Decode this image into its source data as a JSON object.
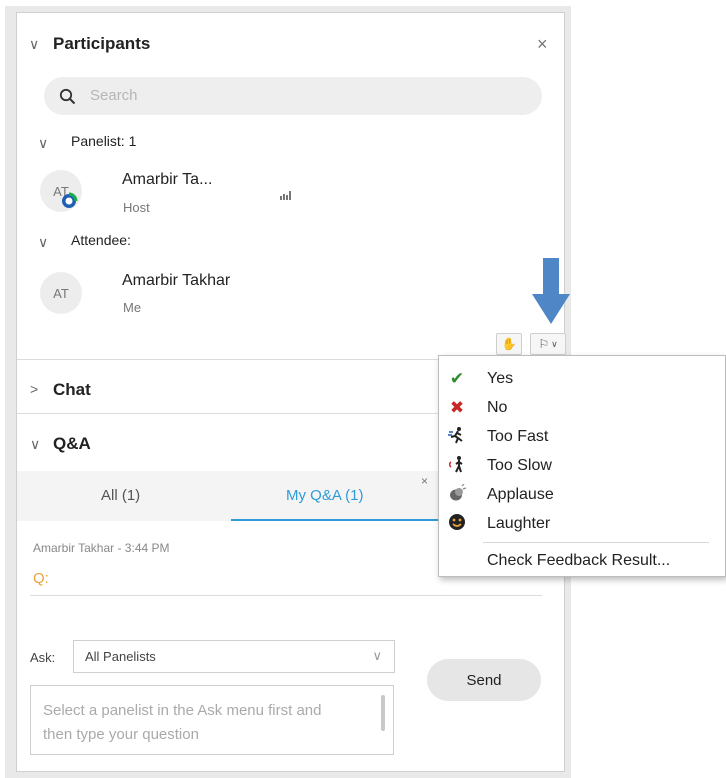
{
  "participants": {
    "title": "Participants",
    "search_placeholder": "Search",
    "panelist_group": "Panelist: 1",
    "attendee_group": "Attendee:",
    "panelist": {
      "initials": "AT",
      "name": "Amarbir Ta...",
      "role": "Host"
    },
    "attendee": {
      "initials": "AT",
      "name": "Amarbir Takhar",
      "role": "Me"
    }
  },
  "chat": {
    "title": "Chat"
  },
  "qa": {
    "title": "Q&A",
    "tabs": [
      "All (1)",
      "My Q&A (1)"
    ],
    "entry_meta": "Amarbir Takhar - 3:44 PM",
    "entry_q": "Q:",
    "ask_label": "Ask:",
    "ask_value": "All Panelists",
    "question_placeholder": "Select a panelist in the Ask menu first and then type your question",
    "send_label": "Send"
  },
  "feedback_menu": {
    "items": [
      {
        "label": "Yes",
        "icon": "checkmark-icon",
        "color": "#2e8b2e"
      },
      {
        "label": "No",
        "icon": "x-icon",
        "color": "#c62828"
      },
      {
        "label": "Too Fast",
        "icon": "running-person-icon",
        "color": "#222222"
      },
      {
        "label": "Too Slow",
        "icon": "walking-person-icon",
        "color": "#222222"
      },
      {
        "label": "Applause",
        "icon": "clapping-hands-icon",
        "color": "#555555"
      },
      {
        "label": "Laughter",
        "icon": "smiley-icon",
        "color": "#222222"
      }
    ],
    "check_result": "Check Feedback Result..."
  },
  "colors": {
    "accent_blue": "#2f9bd8",
    "arrow_blue": "#4f86c6",
    "question_orange": "#e8a33c"
  }
}
